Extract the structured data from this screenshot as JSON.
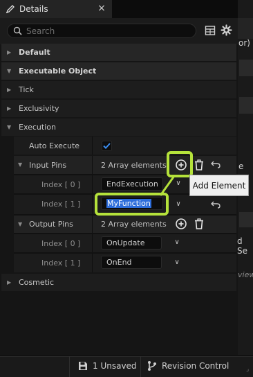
{
  "window": {
    "tab_title": "Details",
    "close_symbol": "×"
  },
  "search": {
    "placeholder": "Search"
  },
  "categories": {
    "default": "Default",
    "executable_object": "Executable Object",
    "tick": "Tick",
    "exclusivity": "Exclusivity",
    "execution": "Execution",
    "cosmetic": "Cosmetic"
  },
  "execution": {
    "auto_execute_label": "Auto Execute",
    "auto_execute_checked": true,
    "input_pins": {
      "label": "Input Pins",
      "count_text": "2 Array elements",
      "items": [
        {
          "index_label": "Index [ 0 ]",
          "value": "EndExecution"
        },
        {
          "index_label": "Index [ 1 ]",
          "value": "MyFunction"
        }
      ]
    },
    "output_pins": {
      "label": "Output Pins",
      "count_text": "2 Array elements",
      "items": [
        {
          "index_label": "Index [ 0 ]",
          "value": "OnUpdate"
        },
        {
          "index_label": "Index [ 1 ]",
          "value": "OnEnd"
        }
      ]
    }
  },
  "tooltip": {
    "text": "Add Element"
  },
  "right_strip": {
    "line1": "or)",
    "line2": "e",
    "line3": "d Se",
    "line4": "view"
  },
  "status_bar": {
    "unsaved": "1 Unsaved",
    "revision_control": "Revision Control"
  },
  "colors": {
    "highlight": "#b5e23b",
    "selection": "#2d6ddb",
    "panel_bg": "#151515",
    "category_bg": "#262626"
  },
  "icons": [
    "pencil-icon",
    "close-icon",
    "search-icon",
    "table-grid-icon",
    "gear-icon",
    "arrow-icon",
    "checkbox-icon",
    "add-circle-icon",
    "trash-icon",
    "reset-arrow-icon",
    "chevron-down-icon",
    "save-icon",
    "branch-icon"
  ]
}
